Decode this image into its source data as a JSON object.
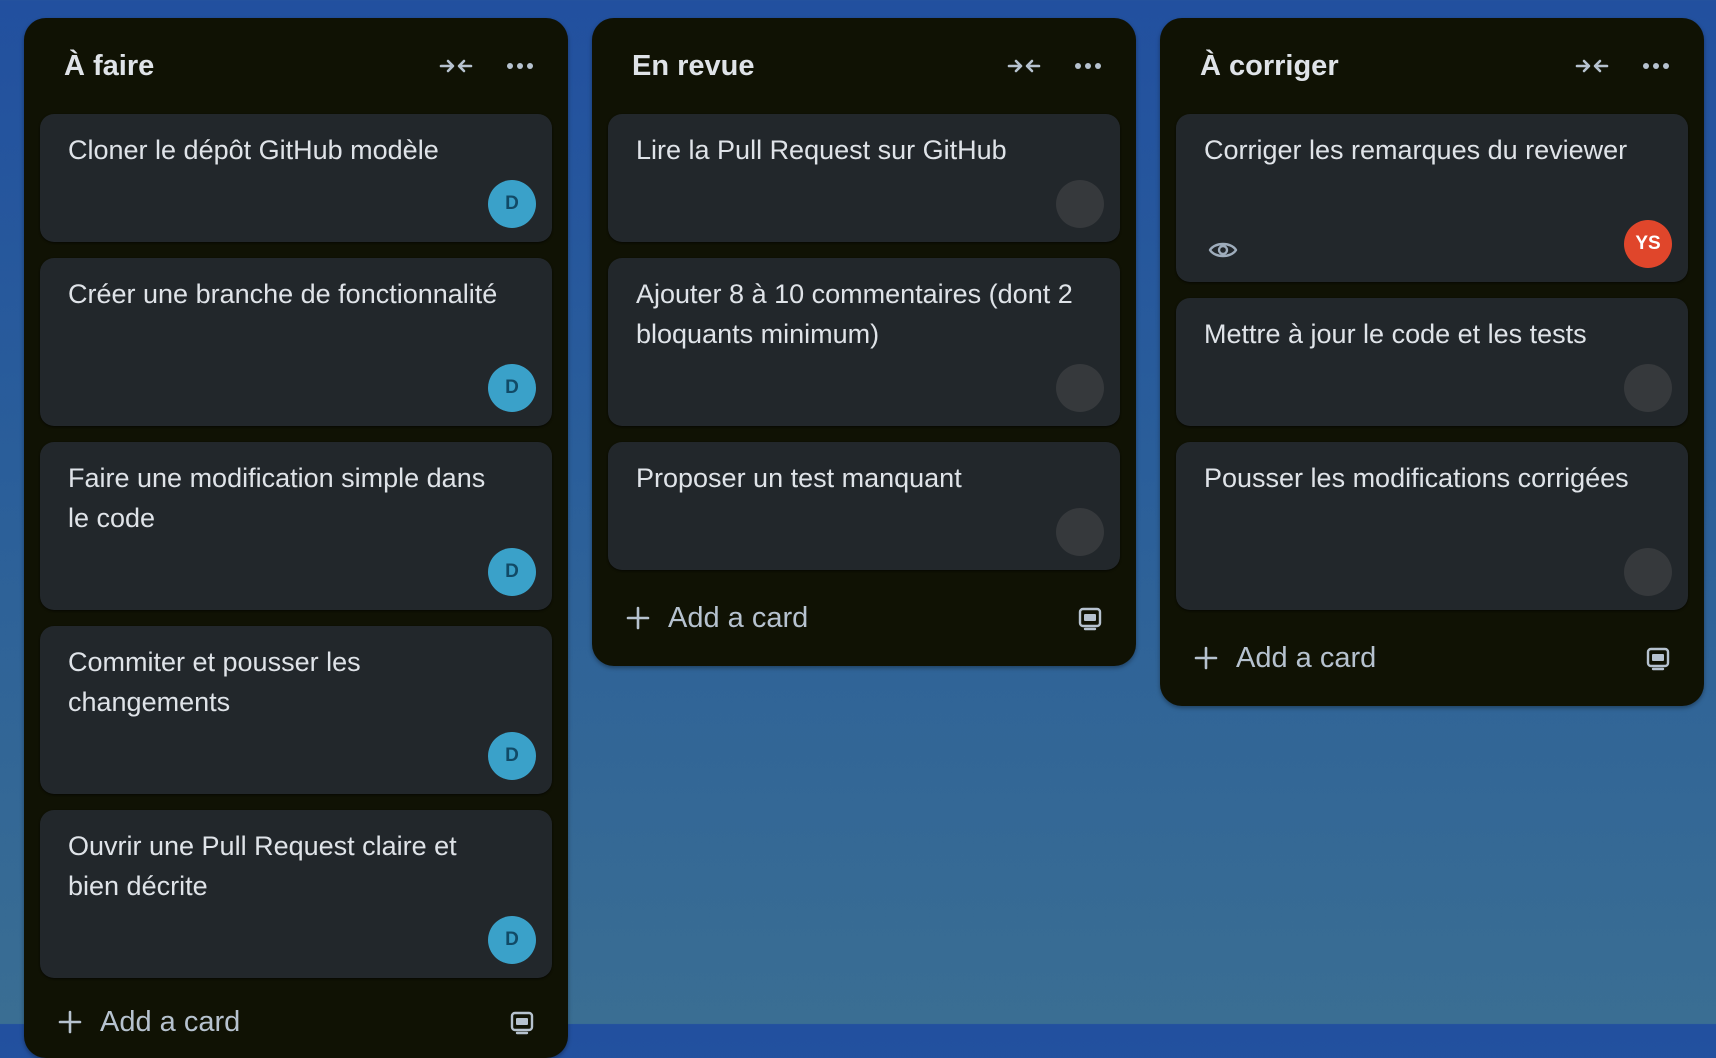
{
  "board": {
    "lists": [
      {
        "title": "À faire",
        "cards": [
          {
            "title": "Cloner le dépôt GitHub modèle",
            "avatar": "D"
          },
          {
            "title": "Créer une branche de fonctionnalité",
            "avatar": "D"
          },
          {
            "title": "Faire une modification simple dans le code",
            "avatar": "D"
          },
          {
            "title": "Commiter et pousser les changements",
            "avatar": "D"
          },
          {
            "title": "Ouvrir une Pull Request claire et bien décrite",
            "avatar": "D"
          }
        ],
        "add_card_label": "Add a card"
      },
      {
        "title": "En revue",
        "cards": [
          {
            "title": "Lire la Pull Request sur GitHub",
            "avatar": ""
          },
          {
            "title": "Ajouter 8 à 10 commentaires (dont 2 bloquants minimum)",
            "avatar": ""
          },
          {
            "title": "Proposer un test manquant",
            "avatar": ""
          }
        ],
        "add_card_label": "Add a card"
      },
      {
        "title": "À corriger",
        "cards": [
          {
            "title": "Corriger les remarques du reviewer",
            "avatar": "YS",
            "icons": [
              "eye-icon"
            ]
          },
          {
            "title": "Mettre à jour le code et les tests",
            "avatar": ""
          },
          {
            "title": "Pousser les modifications corrigées",
            "avatar": ""
          }
        ],
        "add_card_label": "Add a card"
      }
    ]
  },
  "colors": {
    "board_background_top": "#22509f",
    "board_background_bottom": "#3a6e93",
    "list_background": "#101204",
    "card_background": "#22272b",
    "text": "#dfe3e8",
    "avatar_d": "#3aa1c9",
    "avatar_ys": "#e0462b",
    "avatar_empty": "#36393c"
  },
  "icons": {
    "collapse": "collapse-arrows-icon",
    "more": "more-icon",
    "add": "plus-icon",
    "template": "card-template-icon",
    "watch": "eye-icon"
  }
}
